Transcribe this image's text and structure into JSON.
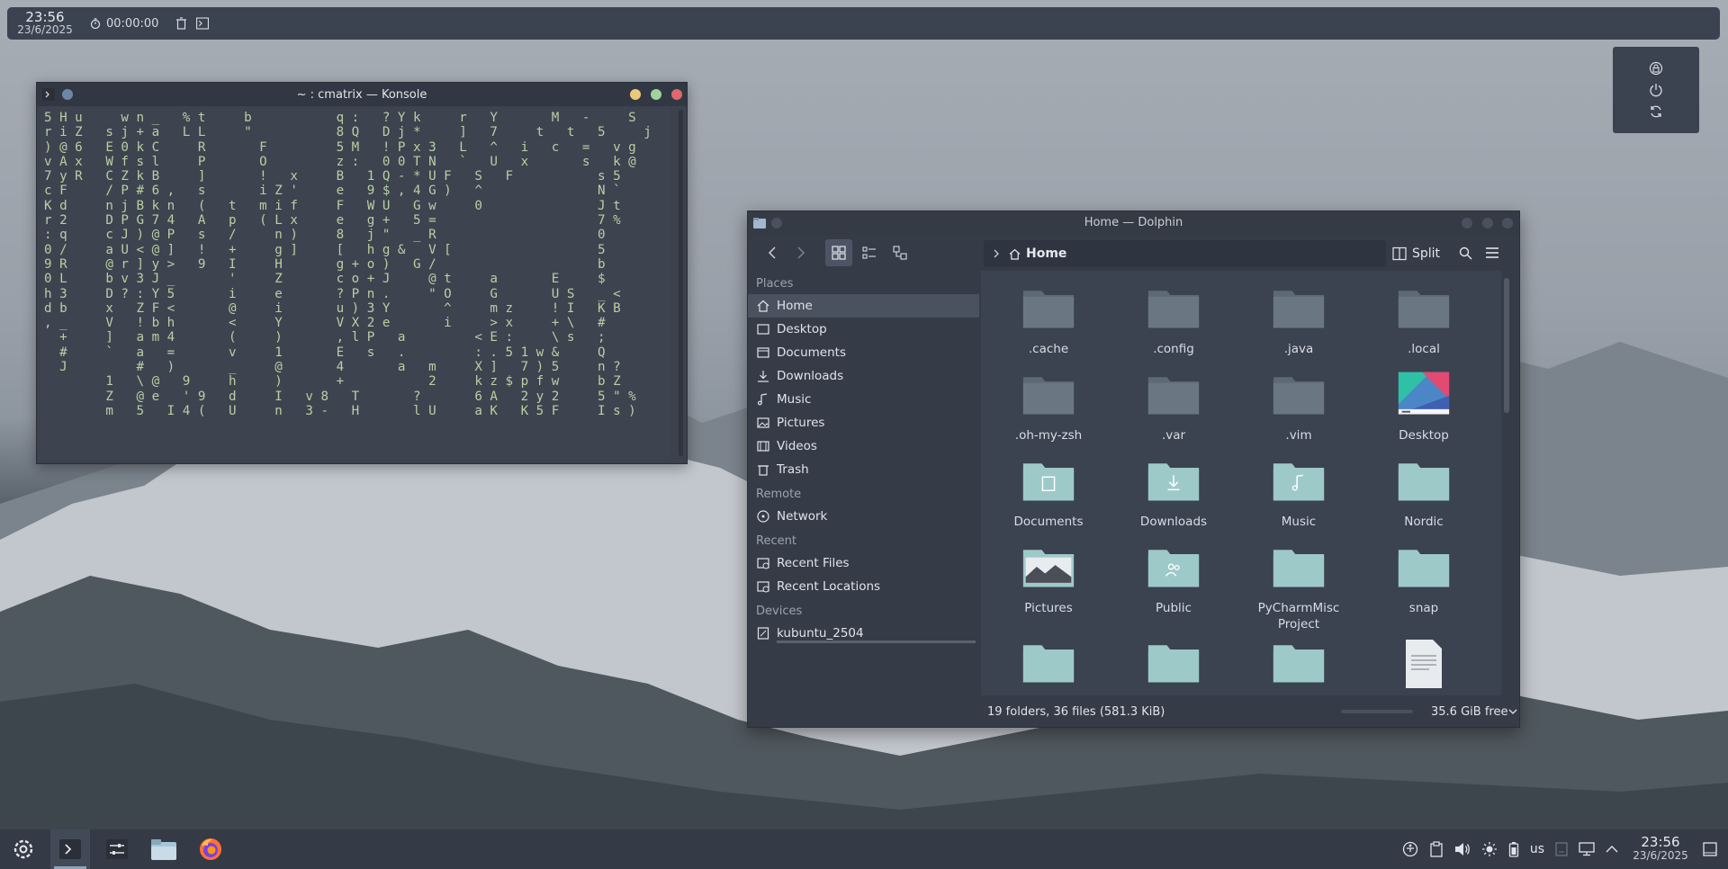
{
  "top_panel": {
    "time": "23:56",
    "date": "23/6/2025",
    "timer": "00:00:00"
  },
  "konsole": {
    "title": "~ : cmatrix — Konsole",
    "matrix_lines": [
      "5 H u     w n _   % t     b           q :   ? Y k     r   Y       M   -     S",
      "r i Z   s j + a   L L     \"           8 Q   D j *     ]   7     t   t   5     j",
      ") @ 6   E 0 k C     R       F         5 M   ! P x 3   L   ^   i   c   =   v g",
      "v A x   W f s l     P       O         z :   0 0 T N   `   U   x       s   k @",
      "7 y R   C Z k B     ]       !   x     B   1 Q - * U F   S   F           s 5",
      "c F     / P # 6 ,   s       i Z '     e   9 $ , 4 G )   ^               N `",
      "K d     n j B k n   (   t   m i f     F   W U   G w     0               J t",
      "r 2     D P G 7 4   A   p   ( L x     e   g +   5 =                     7 %",
      ": q     c J ) @ P   s   /     n )     8   j \"   _ R                     0",
      "0 /     a U < @ ]   !   +     g ]     [   h g &   V [                   5",
      "9 R     @ r ] y >   9   I     H       g + o )   G /                     b",
      "0 L     b v 3 J _       '     Z       c o + J     @ t     a       E     $",
      "h 3     D ? : Y 5       i     e       ? P n .     \" O     G       U S   _ <",
      "d b     x   Z F <       @     i       u ) 3 Y       ^     m z     ! I   K B",
      ", _     V   ! b h       <     Y       V X 2 e       i     > x     + \\   #",
      "  +     ]   a m 4       (     )       , l P   a         < E :     \\ s   ;",
      "  #     `   a   =       v     1       E   s   .         : . 5 1 w &     Q",
      "  J         #   )       _     @       4       a   m     X ]   7 ) 5     n ?",
      "        1   \\ @   9     h     )       +           2     k z $ p f w     b Z",
      "        Z   @ e   ' 9   d     I   v 8   T       ?       6 A   2 y 2     5 \" %",
      "        m   5   I 4 (   U     n   3 -   H       l U     a K   K 5 F     I s )"
    ]
  },
  "dolphin": {
    "title": "Home — Dolphin",
    "breadcrumb": "Home",
    "split_label": "Split",
    "places": {
      "places_heading": "Places",
      "places_items": [
        "Home",
        "Desktop",
        "Documents",
        "Downloads",
        "Music",
        "Pictures",
        "Videos",
        "Trash"
      ],
      "remote_heading": "Remote",
      "remote_items": [
        "Network"
      ],
      "recent_heading": "Recent",
      "recent_items": [
        "Recent Files",
        "Recent Locations"
      ],
      "devices_heading": "Devices",
      "devices_items": [
        "kubuntu_2504"
      ]
    },
    "files": [
      {
        "name": ".cache",
        "icon": "folder-icon"
      },
      {
        "name": ".config",
        "icon": "folder-icon"
      },
      {
        "name": ".java",
        "icon": "folder-icon"
      },
      {
        "name": ".local",
        "icon": "folder-icon"
      },
      {
        "name": ".oh-my-zsh",
        "icon": "folder-icon"
      },
      {
        "name": ".var",
        "icon": "folder-icon"
      },
      {
        "name": ".vim",
        "icon": "folder-icon"
      },
      {
        "name": "Desktop",
        "icon": "desktop-folder-icon"
      },
      {
        "name": "Documents",
        "icon": "documents-folder-icon"
      },
      {
        "name": "Downloads",
        "icon": "downloads-folder-icon"
      },
      {
        "name": "Music",
        "icon": "music-folder-icon"
      },
      {
        "name": "Nordic",
        "icon": "folder-icon"
      },
      {
        "name": "Pictures",
        "icon": "pictures-folder-icon"
      },
      {
        "name": "Public",
        "icon": "public-folder-icon"
      },
      {
        "name": "PyCharmMisc Project",
        "icon": "folder-icon"
      },
      {
        "name": "snap",
        "icon": "folder-icon"
      }
    ],
    "status": "19 folders, 36 files (581.3 KiB)",
    "free_space": "35.6 GiB free"
  },
  "taskbar": {
    "apps": [
      "app-launcher-icon",
      "konsole-icon",
      "settings-icon",
      "dolphin-icon",
      "firefox-icon"
    ],
    "keyboard_layout": "us",
    "time": "23:56",
    "date": "23/6/2025"
  },
  "colors": {
    "panel": "#3c4350",
    "folder": "#9ec9c9",
    "folder_dark": "#5d6a76",
    "matrix_text": "#b9cfa1",
    "close_red": "#e0676b",
    "maximize_green": "#9fd39c",
    "minimize_yellow": "#ecc97a"
  }
}
